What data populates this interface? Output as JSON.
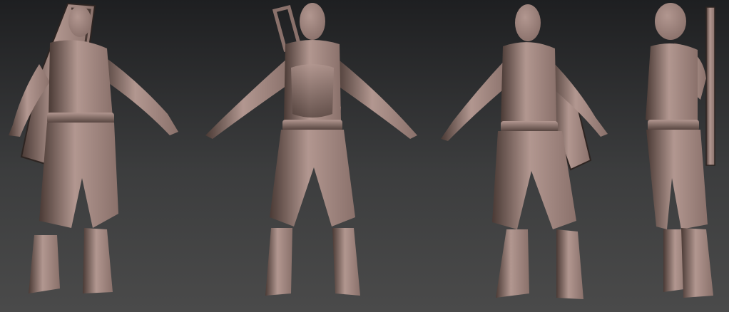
{
  "scene": {
    "description_visible_text": "",
    "views": [
      {
        "id": "back"
      },
      {
        "id": "front"
      },
      {
        "id": "three-quarter"
      },
      {
        "id": "side"
      }
    ]
  },
  "colors": {
    "background_top": "#1e1f21",
    "background_mid": "#3c3d3e",
    "background_bottom": "#4a4a4a",
    "clay_base": "#8a716b",
    "clay_light": "#b29790",
    "clay_dark": "#4a3a35",
    "clay_shadow": "#2d2421"
  }
}
